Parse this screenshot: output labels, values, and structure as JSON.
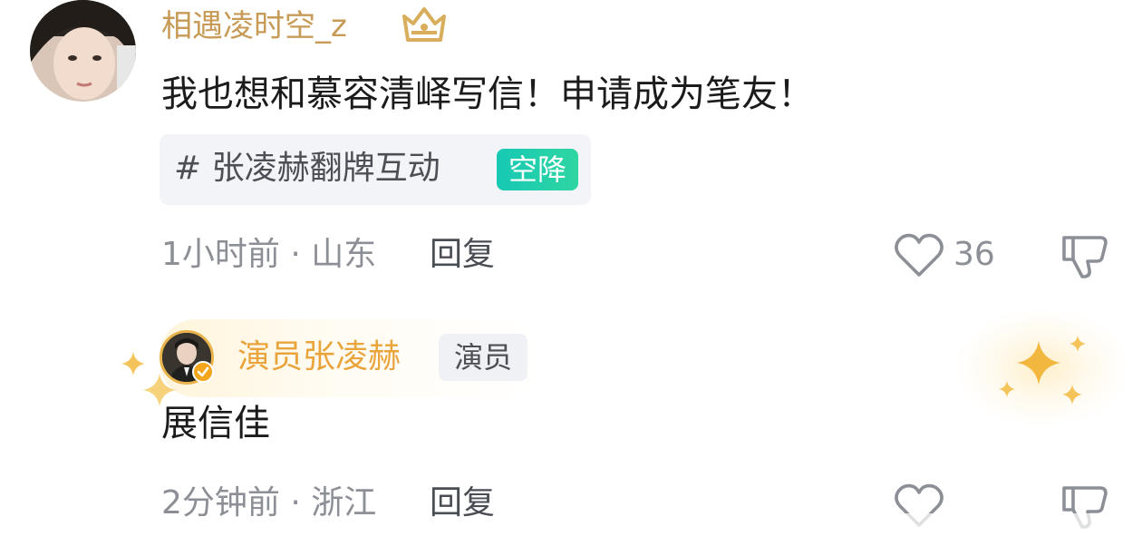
{
  "comment": {
    "username": "相遇凌时空_z",
    "text": "我也想和慕容清峄写信！申请成为笔友！",
    "topic": {
      "text": "# 张凌赫翻牌互动",
      "badge": "空降"
    },
    "meta": "1小时前 · 山东",
    "reply_label": "回复",
    "like_count": "36",
    "icons": [
      "crown-badge-icon",
      "heart-icon",
      "dislike-icon"
    ]
  },
  "reply": {
    "username": "演员张凌赫",
    "role_tag": "演员",
    "text": "展信佳",
    "meta": "2分钟前 · 浙江",
    "reply_label": "回复",
    "icons": [
      "verified-icon",
      "sparkle-icon",
      "heart-icon",
      "dislike-icon"
    ]
  },
  "colors": {
    "username_gold": "#c79a56",
    "reply_username_orange": "#e9a43b",
    "badge_teal": "#16c9b4",
    "meta_gray": "#8c8f95",
    "body_text": "#1b1b1b"
  }
}
